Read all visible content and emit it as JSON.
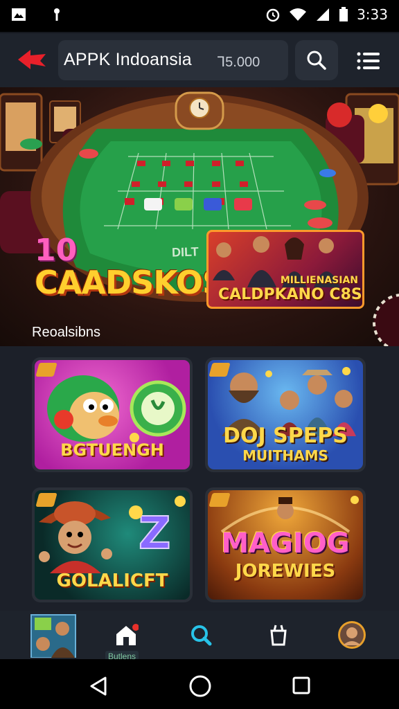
{
  "status_bar": {
    "time": "3:33",
    "icons": [
      "image-icon",
      "location-icon",
      "alarm-icon",
      "wifi-icon",
      "signal-icon",
      "battery-icon"
    ]
  },
  "app_bar": {
    "title": "APPK Indoansia",
    "balance": "Ꞁ5.000",
    "back_icon": "back-arrow-icon",
    "search_icon": "search-icon",
    "menu_icon": "hamburger-menu-icon"
  },
  "hero": {
    "badge_number": "10",
    "badge_title": "CAADSKOS",
    "felt_text": "DILT",
    "promo_top": "MILLIENASIAN",
    "promo_bottom": "CALDPKANO C8S",
    "section_label": "Reoalsibns"
  },
  "games": [
    {
      "title": "BGTUENGH",
      "colors": [
        "#c42bb0",
        "#f03fae"
      ]
    },
    {
      "title_line1": "DOJ SPEPS",
      "title_line2": "MUITHAMS",
      "colors": [
        "#2b4fb3",
        "#5aa0e8"
      ]
    },
    {
      "title": "GOLALICFT",
      "colors": [
        "#0f3e3a",
        "#1f7a6a"
      ]
    },
    {
      "title_line1": "MAGIOG",
      "title_line2": "JOREWIES",
      "colors": [
        "#7a2a0f",
        "#e8901f"
      ]
    }
  ],
  "bottom_nav": {
    "items": [
      "game-thumbnail",
      "home-icon",
      "search-icon",
      "basket-icon",
      "profile-avatar"
    ],
    "active_label": "Butlens",
    "accent": "#28c3e8"
  },
  "system_nav": [
    "back-triangle-icon",
    "home-circle-icon",
    "recents-square-icon"
  ]
}
